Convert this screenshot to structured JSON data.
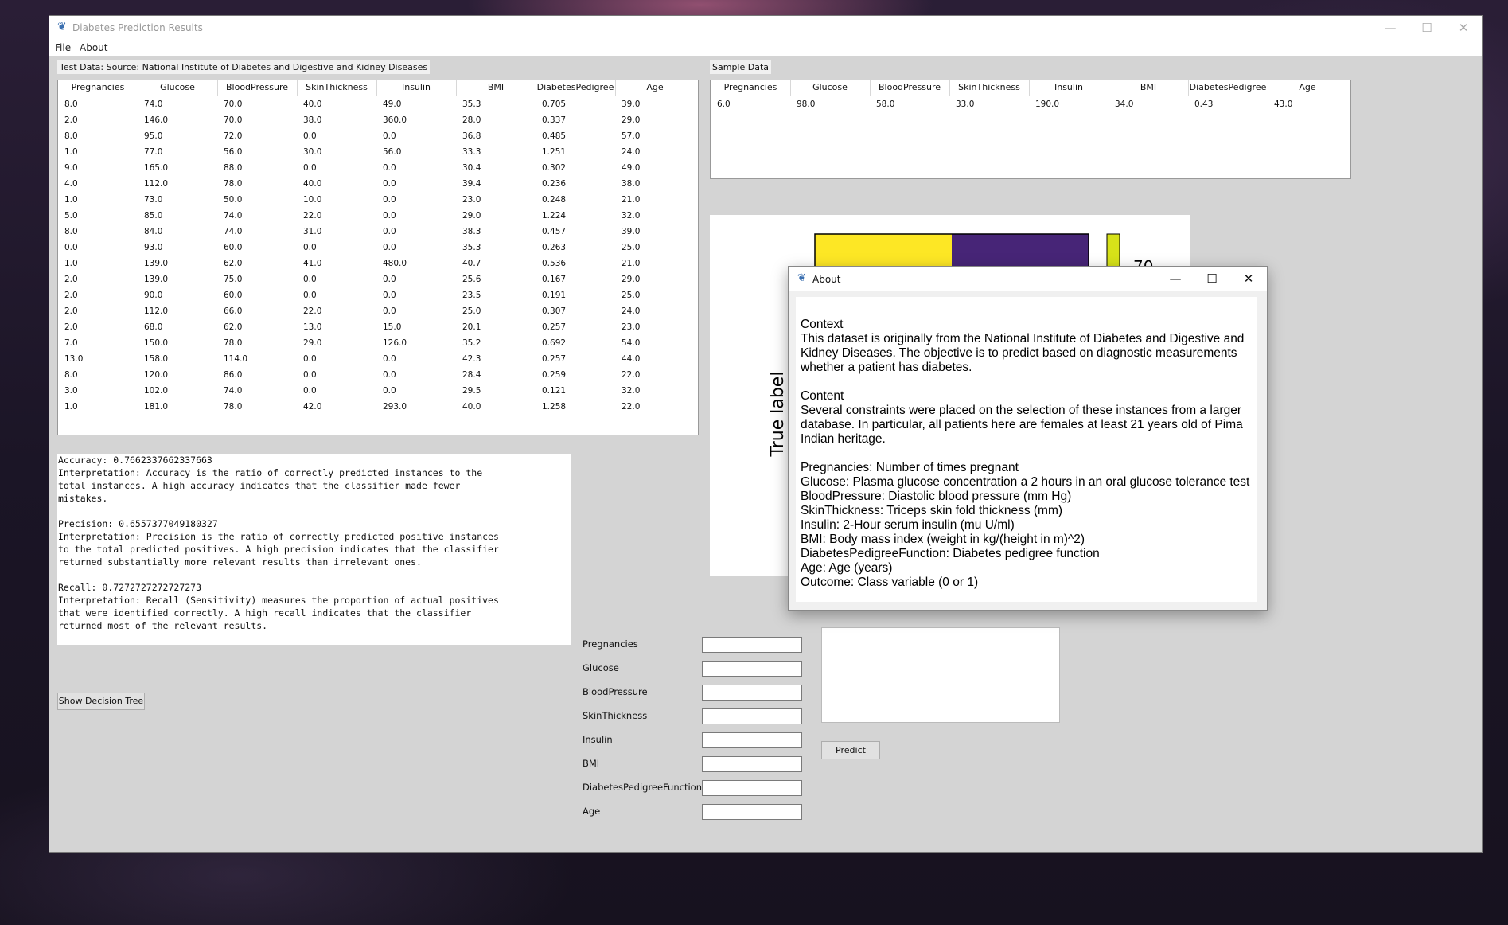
{
  "window": {
    "title": "Diabetes Prediction Results",
    "minimize_glyph": "—",
    "maximize_glyph": "☐",
    "close_glyph": "✕"
  },
  "menu": {
    "file": "File",
    "about": "About"
  },
  "test_table": {
    "label": "Test Data: Source: National Institute of Diabetes and Digestive and Kidney Diseases",
    "columns": [
      "Pregnancies",
      "Glucose",
      "BloodPressure",
      "SkinThickness",
      "Insulin",
      "BMI",
      "DiabetesPedigree",
      "Age"
    ],
    "rows": [
      [
        "8.0",
        "74.0",
        "70.0",
        "40.0",
        "49.0",
        "35.3",
        "0.705",
        "39.0"
      ],
      [
        "2.0",
        "146.0",
        "70.0",
        "38.0",
        "360.0",
        "28.0",
        "0.337",
        "29.0"
      ],
      [
        "8.0",
        "95.0",
        "72.0",
        "0.0",
        "0.0",
        "36.8",
        "0.485",
        "57.0"
      ],
      [
        "1.0",
        "77.0",
        "56.0",
        "30.0",
        "56.0",
        "33.3",
        "1.251",
        "24.0"
      ],
      [
        "9.0",
        "165.0",
        "88.0",
        "0.0",
        "0.0",
        "30.4",
        "0.302",
        "49.0"
      ],
      [
        "4.0",
        "112.0",
        "78.0",
        "40.0",
        "0.0",
        "39.4",
        "0.236",
        "38.0"
      ],
      [
        "1.0",
        "73.0",
        "50.0",
        "10.0",
        "0.0",
        "23.0",
        "0.248",
        "21.0"
      ],
      [
        "5.0",
        "85.0",
        "74.0",
        "22.0",
        "0.0",
        "29.0",
        "1.224",
        "32.0"
      ],
      [
        "8.0",
        "84.0",
        "74.0",
        "31.0",
        "0.0",
        "38.3",
        "0.457",
        "39.0"
      ],
      [
        "0.0",
        "93.0",
        "60.0",
        "0.0",
        "0.0",
        "35.3",
        "0.263",
        "25.0"
      ],
      [
        "1.0",
        "139.0",
        "62.0",
        "41.0",
        "480.0",
        "40.7",
        "0.536",
        "21.0"
      ],
      [
        "2.0",
        "139.0",
        "75.0",
        "0.0",
        "0.0",
        "25.6",
        "0.167",
        "29.0"
      ],
      [
        "2.0",
        "90.0",
        "60.0",
        "0.0",
        "0.0",
        "23.5",
        "0.191",
        "25.0"
      ],
      [
        "2.0",
        "112.0",
        "66.0",
        "22.0",
        "0.0",
        "25.0",
        "0.307",
        "24.0"
      ],
      [
        "2.0",
        "68.0",
        "62.0",
        "13.0",
        "15.0",
        "20.1",
        "0.257",
        "23.0"
      ],
      [
        "7.0",
        "150.0",
        "78.0",
        "29.0",
        "126.0",
        "35.2",
        "0.692",
        "54.0"
      ],
      [
        "13.0",
        "158.0",
        "114.0",
        "0.0",
        "0.0",
        "42.3",
        "0.257",
        "44.0"
      ],
      [
        "8.0",
        "120.0",
        "86.0",
        "0.0",
        "0.0",
        "28.4",
        "0.259",
        "22.0"
      ],
      [
        "3.0",
        "102.0",
        "74.0",
        "0.0",
        "0.0",
        "29.5",
        "0.121",
        "32.0"
      ],
      [
        "1.0",
        "181.0",
        "78.0",
        "42.0",
        "293.0",
        "40.0",
        "1.258",
        "22.0"
      ]
    ]
  },
  "sample_table": {
    "label": "Sample Data",
    "columns": [
      "Pregnancies",
      "Glucose",
      "BloodPressure",
      "SkinThickness",
      "Insulin",
      "BMI",
      "DiabetesPedigree",
      "Age"
    ],
    "rows": [
      [
        "6.0",
        "98.0",
        "58.0",
        "33.0",
        "190.0",
        "34.0",
        "0.43",
        "43.0"
      ]
    ]
  },
  "metrics_text": "Accuracy: 0.7662337662337663\nInterpretation: Accuracy is the ratio of correctly predicted instances to the\ntotal instances. A high accuracy indicates that the classifier made fewer\nmistakes.\n\nPrecision: 0.6557377049180327\nInterpretation: Precision is the ratio of correctly predicted positive instances\nto the total predicted positives. A high precision indicates that the classifier\nreturned substantially more relevant results than irrelevant ones.\n\nRecall: 0.7272727272727273\nInterpretation: Recall (Sensitivity) measures the proportion of actual positives\nthat were identified correctly. A high recall indicates that the classifier\nreturned most of the relevant results.",
  "show_tree_button": "Show Decision Tree",
  "form": {
    "fields": [
      "Pregnancies",
      "Glucose",
      "BloodPressure",
      "SkinThickness",
      "Insulin",
      "BMI",
      "DiabetesPedigreeFunction",
      "Age"
    ],
    "values": [
      "",
      "",
      "",
      "",
      "",
      "",
      "",
      ""
    ],
    "predict_button": "Predict",
    "output": ""
  },
  "plot": {
    "ylabel": "True label",
    "colorbar_tick": "70",
    "colors": {
      "yellow": "#fde725",
      "purple": "#472577",
      "colorbar": "#d7e219"
    }
  },
  "about_dialog": {
    "title": "About",
    "lines": [
      "Context",
      "This dataset is originally from the National Institute of Diabetes and Digestive and",
      "Kidney Diseases. The objective is to predict based on diagnostic measurements",
      "whether a patient has diabetes.",
      "",
      "Content",
      "Several constraints were placed on the selection of these instances from a larger",
      "database. In particular, all patients here are females at least 21 years old of Pima",
      "Indian heritage.",
      "",
      "Pregnancies: Number of times pregnant",
      "Glucose: Plasma glucose concentration a 2 hours in an oral glucose tolerance test",
      "BloodPressure: Diastolic blood pressure (mm Hg)",
      "SkinThickness: Triceps skin fold thickness (mm)",
      "Insulin: 2-Hour serum insulin (mu U/ml)",
      "BMI: Body mass index (weight in kg/(height in m)^2)",
      "DiabetesPedigreeFunction: Diabetes pedigree function",
      "Age: Age (years)",
      "Outcome: Class variable (0 or 1)"
    ]
  }
}
